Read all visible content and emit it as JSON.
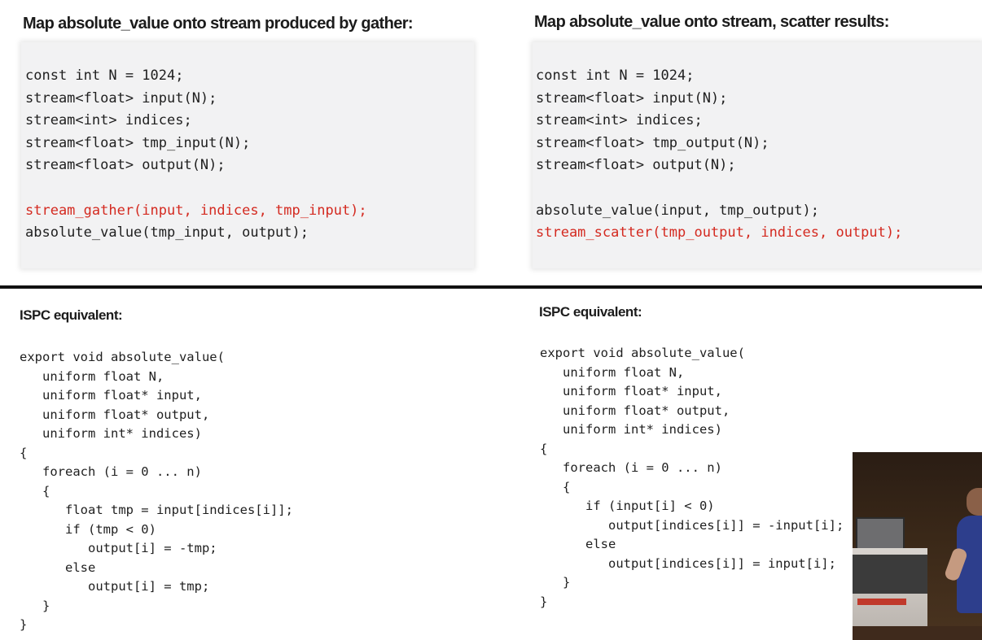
{
  "top_left": {
    "heading": "Map absolute_value onto stream produced by gather:",
    "code": [
      "const int N = 1024;",
      "stream<float> input(N);",
      "stream<int> indices;",
      "stream<float> tmp_input(N);",
      "stream<float> output(N);",
      "",
      "stream_gather(input, indices, tmp_input);",
      "absolute_value(tmp_input, output);"
    ],
    "highlight_line": "stream_gather(input, indices, tmp_input);"
  },
  "top_right": {
    "heading": "Map absolute_value onto stream, scatter results:",
    "code": [
      "const int N = 1024;",
      "stream<float> input(N);",
      "stream<int> indices;",
      "stream<float> tmp_output(N);",
      "stream<float> output(N);",
      "",
      "absolute_value(input, tmp_output);",
      "stream_scatter(tmp_output, indices, output);"
    ],
    "highlight_line": "stream_scatter(tmp_output, indices, output);"
  },
  "bottom_left": {
    "heading": "ISPC equivalent:",
    "code": [
      "export void absolute_value(",
      "   uniform float N,",
      "   uniform float* input,",
      "   uniform float* output,",
      "   uniform int* indices)",
      "{",
      "   foreach (i = 0 ... n)",
      "   {",
      "      float tmp = input[indices[i]];",
      "      if (tmp < 0)",
      "         output[i] = -tmp;",
      "      else",
      "         output[i] = tmp;",
      "   }",
      "}"
    ]
  },
  "bottom_right": {
    "heading": "ISPC equivalent:",
    "code": [
      "export void absolute_value(",
      "   uniform float N,",
      "   uniform float* input,",
      "   uniform float* output,",
      "   uniform int* indices)",
      "{",
      "   foreach (i = 0 ... n)",
      "   {",
      "      if (input[i] < 0)",
      "         output[indices[i]] = -input[i];",
      "      else",
      "         output[indices[i]] = input[i];",
      "   }",
      "}"
    ]
  },
  "colors": {
    "highlight": "#d42a20",
    "code_box_bg": "#f2f2f3",
    "divider": "#111111"
  }
}
